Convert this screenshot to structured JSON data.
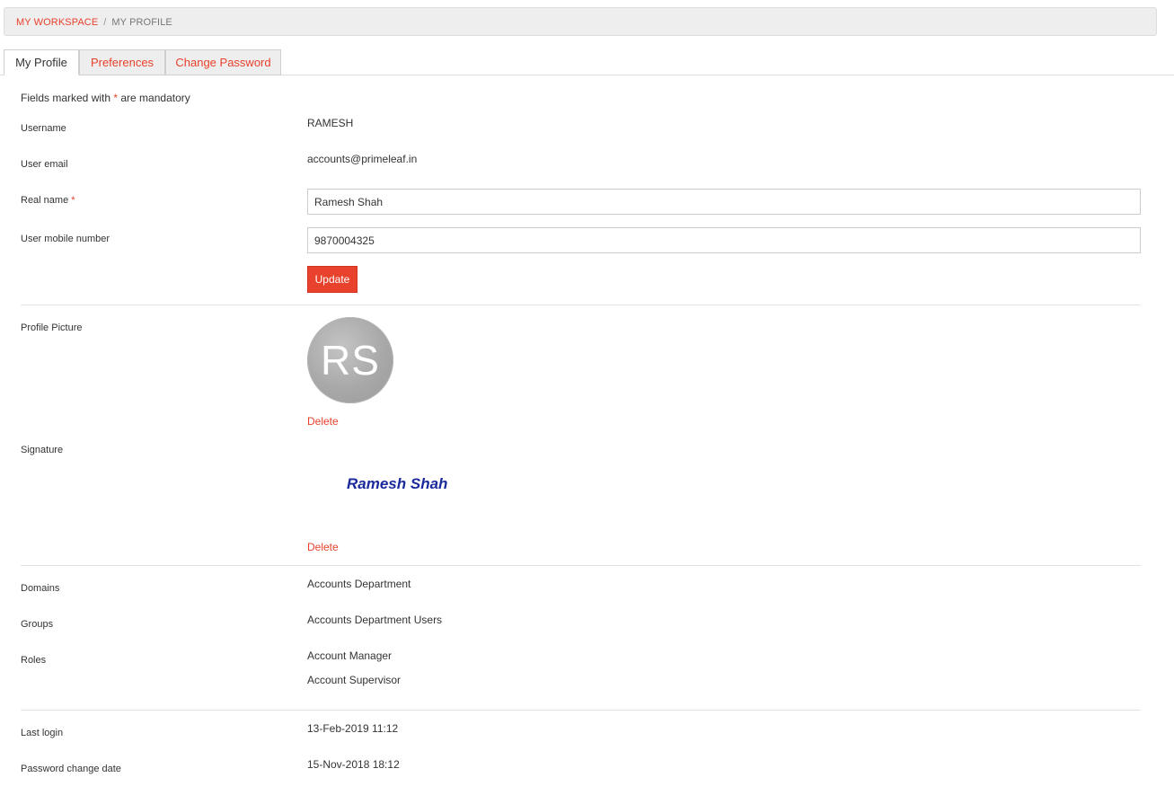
{
  "breadcrumb": {
    "workspace": "MY WORKSPACE",
    "separator": "/",
    "current": "MY PROFILE"
  },
  "tabs": [
    {
      "label": "My Profile",
      "active": true
    },
    {
      "label": "Preferences",
      "active": false
    },
    {
      "label": "Change Password",
      "active": false
    }
  ],
  "form": {
    "mandatory_prefix": "Fields marked with ",
    "mandatory_star": "*",
    "mandatory_suffix": " are mandatory",
    "username_label": "Username",
    "username_value": "RAMESH",
    "email_label": "User email",
    "email_value": "accounts@primeleaf.in",
    "realname_label": "Real name",
    "realname_star": "*",
    "realname_value": "Ramesh Shah",
    "mobile_label": "User mobile number",
    "mobile_value": "9870004325",
    "update_label": "Update"
  },
  "profile_picture": {
    "label": "Profile Picture",
    "initials": "RS",
    "delete_label": "Delete"
  },
  "signature": {
    "label": "Signature",
    "text": "Ramesh Shah",
    "delete_label": "Delete"
  },
  "membership": {
    "domains_label": "Domains",
    "domains_value": "Accounts Department",
    "groups_label": "Groups",
    "groups_value": "Accounts Department Users",
    "roles_label": "Roles",
    "roles": [
      "Account Manager",
      "Account Supervisor"
    ]
  },
  "activity": {
    "last_login_label": "Last login",
    "last_login_value": "13-Feb-2019 11:12",
    "password_change_label": "Password change date",
    "password_change_value": "15-Nov-2018 18:12"
  },
  "colors": {
    "accent": "#e8412c",
    "signature": "#1a2a9c",
    "avatar": "#a8a8a8"
  }
}
